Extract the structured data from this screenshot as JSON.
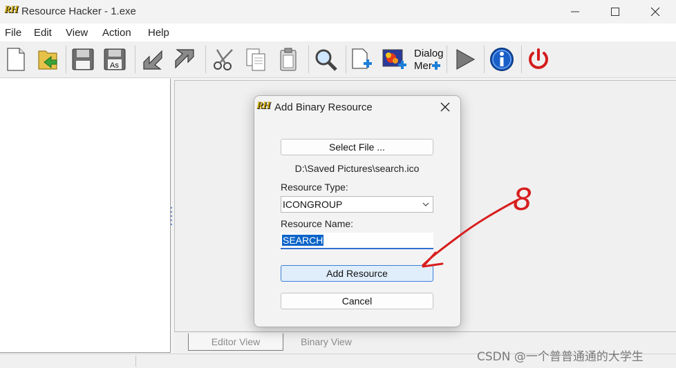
{
  "window": {
    "logo": "RH",
    "title": "Resource Hacker - 1.exe"
  },
  "menu": [
    "File",
    "Edit",
    "View",
    "Action",
    "Help"
  ],
  "toolbar": {
    "dialog_merge_label_top": "Dialog",
    "dialog_merge_label_bottom": "Mer"
  },
  "tabs": {
    "editor": "Editor View",
    "binary": "Binary View"
  },
  "dialog": {
    "logo": "RH",
    "title": "Add Binary Resource",
    "select_file_label": "Select File ...",
    "file_path": "D:\\Saved Pictures\\search.ico",
    "resource_type_label": "Resource Type:",
    "resource_type_value": "ICONGROUP",
    "resource_name_label": "Resource Name:",
    "resource_name_value": "SEARCH",
    "add_resource_label": "Add Resource",
    "cancel_label": "Cancel"
  },
  "annotation": {
    "number": "8",
    "color": "#d81e1e"
  },
  "watermark": "CSDN @一个普普通通的大学生",
  "colors": {
    "accent": "#2f6fd0",
    "selection": "#0a64c8",
    "primary_button_bg": "#e0eefb"
  }
}
